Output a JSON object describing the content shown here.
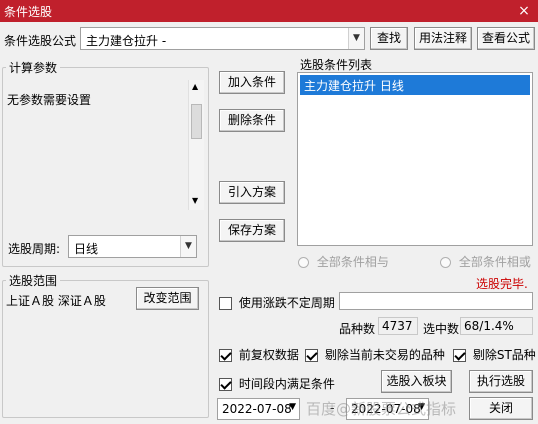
{
  "window": {
    "title": "条件选股",
    "close_label": "×"
  },
  "top_row": {
    "label": "条件选股公式",
    "formula_value": "主力建仓拉升 -",
    "find_button": "查找",
    "usage_button": "用法注释",
    "view_formula_button": "查看公式"
  },
  "params": {
    "legend": "计算参数",
    "message": "无参数需要设置",
    "period_label": "选股周期:",
    "period_value": "日线"
  },
  "middle_buttons": {
    "add": "加入条件",
    "delete": "删除条件",
    "load_plan": "引入方案",
    "save_plan": "保存方案"
  },
  "conditions": {
    "label": "选股条件列表",
    "items": [
      "主力建仓拉升  日线"
    ],
    "radio_and": "全部条件相与",
    "radio_or": "全部条件相或"
  },
  "status": {
    "done_text": "选股完毕.",
    "done_color": "#cc0000"
  },
  "scope": {
    "legend": "选股范围",
    "value": "上证Ａ股 深证Ａ股",
    "change_button": "改变范围"
  },
  "options": {
    "use_limit_period": "使用涨跌不定周期",
    "count_label": "品种数",
    "count_value": "4737",
    "selected_label": "选中数",
    "selected_value": "68/1.4%",
    "pre_adjust": "前复权数据",
    "exclude_untraded": "剔除当前未交易的品种",
    "exclude_st": "剔除ST品种",
    "time_range": "时间段内满足条件",
    "select_to_block": "选股入板块",
    "execute": "执行选股",
    "date_from": "2022-07-08",
    "date_to": "2022-07-08",
    "close_button": "关闭",
    "watermark": "百度@新股票公式指标"
  }
}
